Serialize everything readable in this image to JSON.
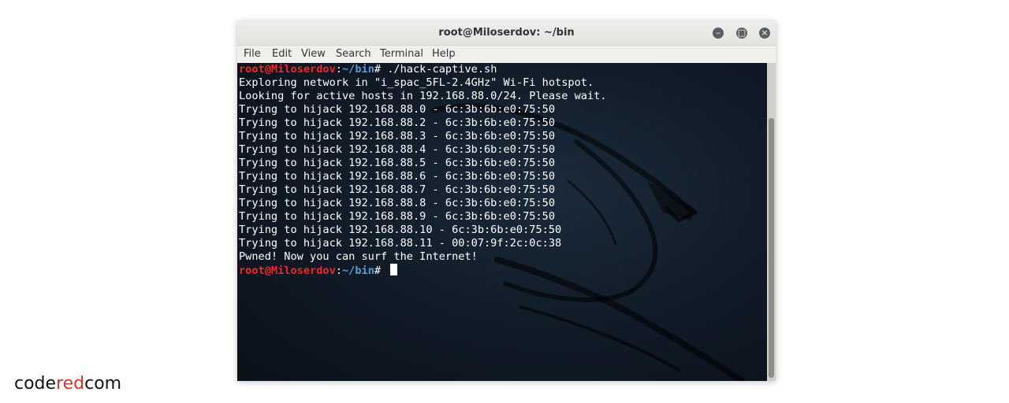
{
  "window": {
    "title": "root@Miloserdov: ~/bin",
    "buttons": {
      "minimize_icon": "minimize-icon",
      "maximize_icon": "maximize-icon",
      "close_icon": "close-icon"
    }
  },
  "menu": [
    "File",
    "Edit",
    "View",
    "Search",
    "Terminal",
    "Help"
  ],
  "terminal": {
    "prompt_user": "root@Miloserdov",
    "prompt_sep": ":",
    "prompt_path": "~/bin",
    "prompt_symbol": "# ",
    "command": "./hack-captive.sh",
    "output": [
      "Exploring network in \"i_spac_5FL-2.4GHz\" Wi-Fi hotspot.",
      "Looking for active hosts in 192.168.88.0/24. Please wait.",
      "Trying to hijack 192.168.88.0 - 6c:3b:6b:e0:75:50",
      "Trying to hijack 192.168.88.2 - 6c:3b:6b:e0:75:50",
      "Trying to hijack 192.168.88.3 - 6c:3b:6b:e0:75:50",
      "Trying to hijack 192.168.88.4 - 6c:3b:6b:e0:75:50",
      "Trying to hijack 192.168.88.5 - 6c:3b:6b:e0:75:50",
      "Trying to hijack 192.168.88.6 - 6c:3b:6b:e0:75:50",
      "Trying to hijack 192.168.88.7 - 6c:3b:6b:e0:75:50",
      "Trying to hijack 192.168.88.8 - 6c:3b:6b:e0:75:50",
      "Trying to hijack 192.168.88.9 - 6c:3b:6b:e0:75:50",
      "Trying to hijack 192.168.88.10 - 6c:3b:6b:e0:75:50",
      "Trying to hijack 192.168.88.11 - 00:07:9f:2c:0c:38",
      "Pwned! Now you can surf the Internet!"
    ]
  },
  "logo": {
    "part1": "code",
    "part2": "red",
    "part3": "com"
  },
  "colors": {
    "prompt_user": "#ef2929",
    "prompt_path": "#5b9bd5",
    "terminal_bg": "#101a26",
    "logo_accent": "#e03127"
  }
}
